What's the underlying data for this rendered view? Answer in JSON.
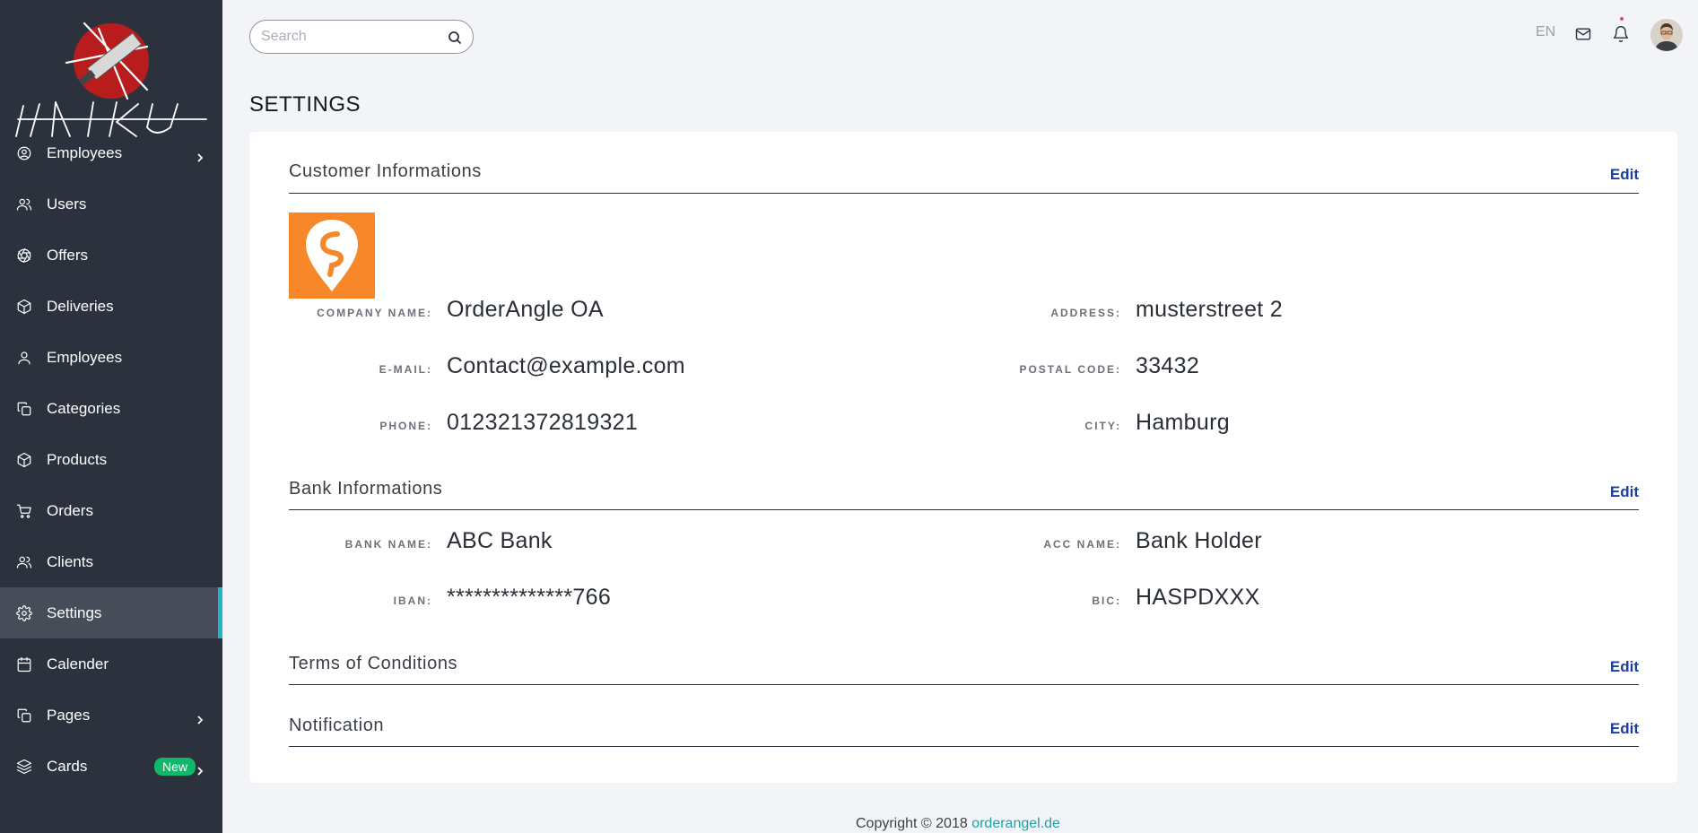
{
  "brand": {
    "name": "HAIKU"
  },
  "sidebar": {
    "items": [
      {
        "label": "Employees",
        "icon": "user-circle-icon",
        "has_chevron": true
      },
      {
        "label": "Users",
        "icon": "users-icon"
      },
      {
        "label": "Offers",
        "icon": "aperture-icon"
      },
      {
        "label": "Deliveries",
        "icon": "box-icon"
      },
      {
        "label": "Employees",
        "icon": "user-icon"
      },
      {
        "label": "Categories",
        "icon": "copy-icon"
      },
      {
        "label": "Products",
        "icon": "box-icon"
      },
      {
        "label": "Orders",
        "icon": "cart-icon"
      },
      {
        "label": "Clients",
        "icon": "users-icon"
      },
      {
        "label": "Settings",
        "icon": "gear-icon",
        "active": true
      },
      {
        "label": "Calender",
        "icon": "calendar-icon"
      },
      {
        "label": "Pages",
        "icon": "copy-icon",
        "has_chevron": true
      },
      {
        "label": "Cards",
        "icon": "layers-icon",
        "has_chevron": true,
        "badge": "New"
      }
    ]
  },
  "topbar": {
    "search_placeholder": "Search",
    "language": "EN"
  },
  "page": {
    "title": "SETTINGS"
  },
  "customer": {
    "title": "Customer Informations",
    "edit": "Edit",
    "company_name_label": "COMPANY NAME:",
    "company_name": "OrderAngle OA",
    "email_label": "E-MAIL:",
    "email": "Contact@example.com",
    "phone_label": "PHONE:",
    "phone": "012321372819321",
    "address_label": "ADDRESS:",
    "address": "musterstreet 2",
    "postal_label": "POSTAL CODE:",
    "postal": "33432",
    "city_label": "CITY:",
    "city": "Hamburg"
  },
  "bank": {
    "title": "Bank Informations",
    "edit": "Edit",
    "bank_name_label": "BANK NAME:",
    "bank_name": "ABC Bank",
    "iban_label": "IBAN:",
    "iban": "**************766",
    "acc_name_label": "ACC NAME:",
    "acc_name": "Bank Holder",
    "bic_label": "BIC:",
    "bic": "HASPDXXX"
  },
  "terms": {
    "title": "Terms of Conditions",
    "edit": "Edit"
  },
  "notification": {
    "title": "Notification",
    "edit": "Edit"
  },
  "footer": {
    "text": "Copyright © 2018",
    "link": "orderangel.de"
  },
  "colors": {
    "sidebar": "#2c323d",
    "active_accent": "#22b3c6",
    "logo_orange": "#f6882a",
    "edit_link": "#1a3fa0",
    "badge_green": "#12b76a"
  }
}
